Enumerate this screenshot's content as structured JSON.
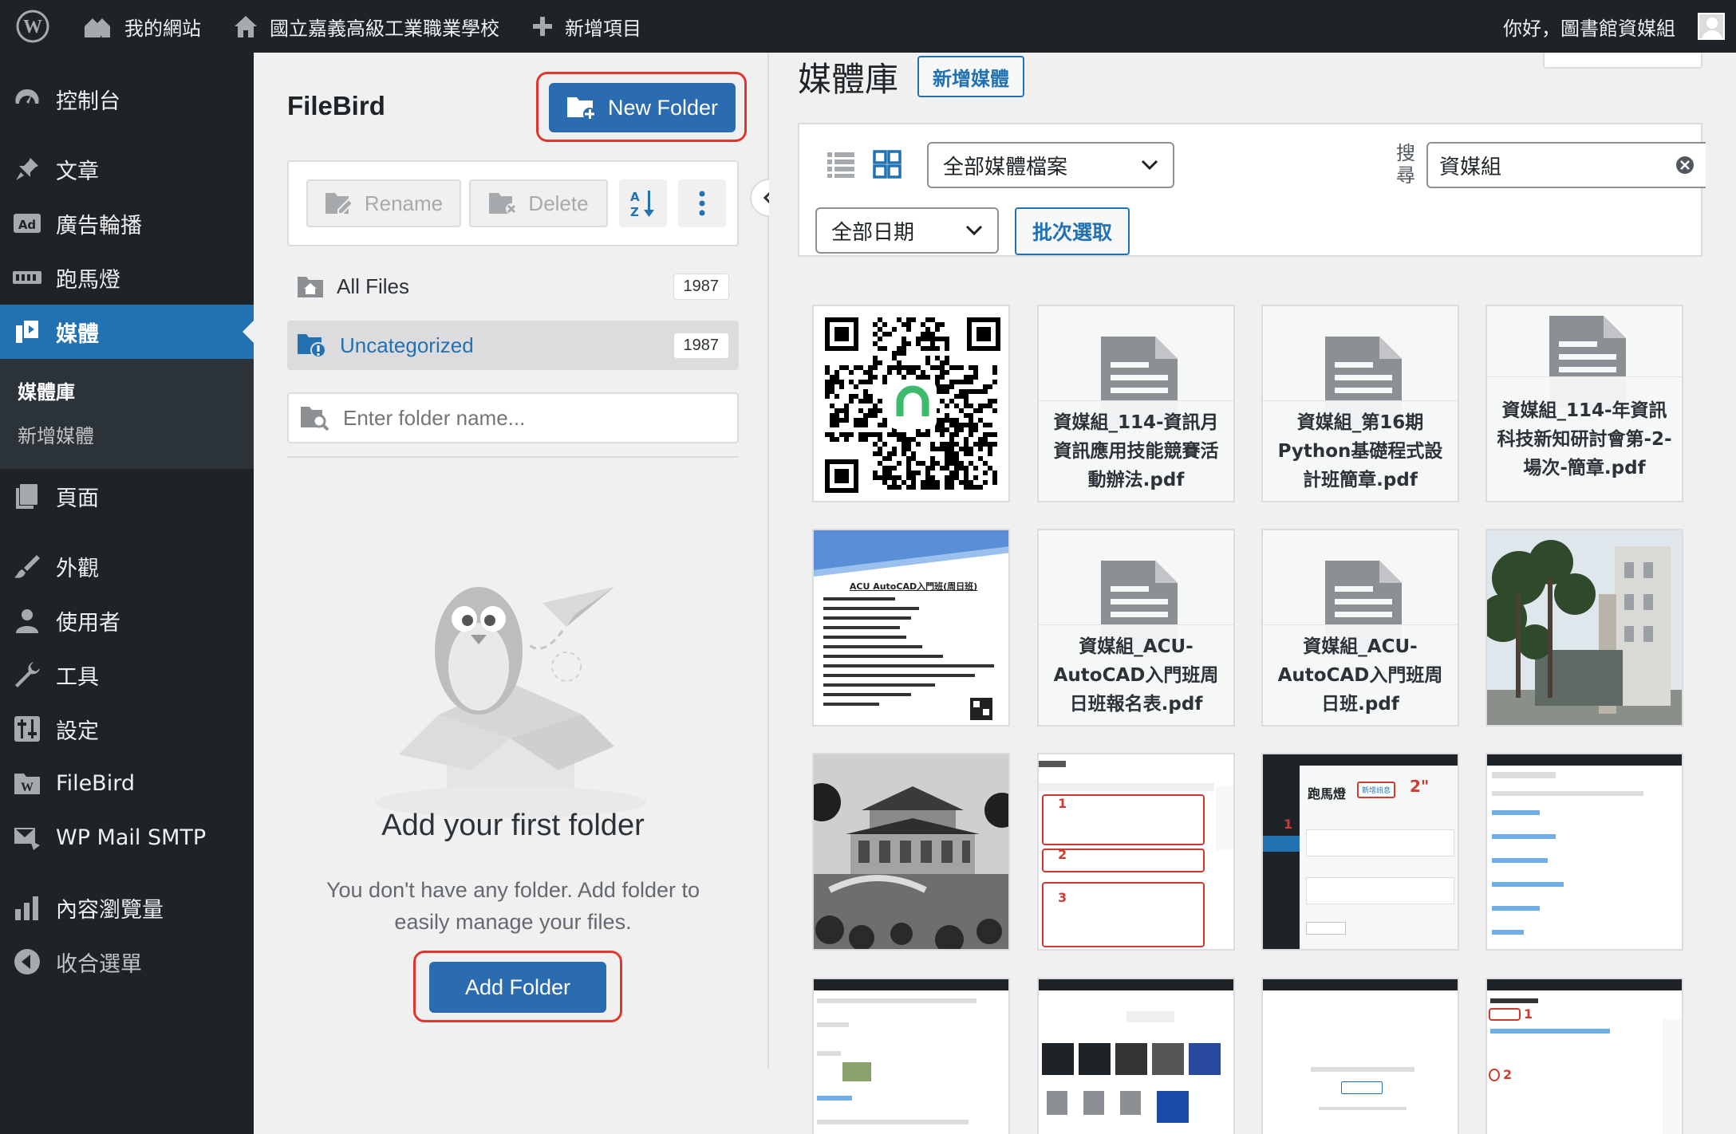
{
  "admin_bar": {
    "my_sites": "我的網站",
    "site_name": "國立嘉義高級工業職業學校",
    "new_item": "新增項目",
    "greeting": "你好，圖書館資媒組"
  },
  "sidebar": {
    "items": [
      {
        "label": "控制台",
        "icon": "dashboard-icon"
      },
      {
        "label": "文章",
        "icon": "pushpin-icon"
      },
      {
        "label": "廣告輪播",
        "icon": "ad-icon"
      },
      {
        "label": "跑馬燈",
        "icon": "marquee-icon"
      },
      {
        "label": "媒體",
        "icon": "media-icon"
      },
      {
        "label": "頁面",
        "icon": "page-icon"
      },
      {
        "label": "外觀",
        "icon": "brush-icon"
      },
      {
        "label": "使用者",
        "icon": "user-icon"
      },
      {
        "label": "工具",
        "icon": "wrench-icon"
      },
      {
        "label": "設定",
        "icon": "settings-icon"
      },
      {
        "label": "FileBird",
        "icon": "filebird-icon"
      },
      {
        "label": "WP Mail SMTP",
        "icon": "mail-icon"
      },
      {
        "label": "內容瀏覽量",
        "icon": "bar-chart-icon"
      },
      {
        "label": "收合選單",
        "icon": "collapse-icon"
      }
    ],
    "submenu": [
      "媒體庫",
      "新增媒體"
    ]
  },
  "filebird": {
    "title": "FileBird",
    "new_folder": "New Folder",
    "rename": "Rename",
    "delete": "Delete",
    "all_files": "All Files",
    "all_files_count": "1987",
    "uncategorized": "Uncategorized",
    "uncategorized_count": "1987",
    "folder_placeholder": "Enter folder name...",
    "empty_title": "Add your first folder",
    "empty_desc": "You don't have any folder. Add folder to easily manage your files.",
    "add_folder": "Add Folder"
  },
  "media": {
    "title": "媒體庫",
    "add_new": "新增媒體",
    "type_filter": "全部媒體檔案",
    "search_label": "搜尋",
    "search_value": "資媒組",
    "date_filter": "全部日期",
    "bulk_select": "批次選取",
    "tiles": [
      {
        "kind": "qr"
      },
      {
        "kind": "doc",
        "name": "資媒組_114-資訊月資訊應用技能競賽活動辦法.pdf"
      },
      {
        "kind": "doc",
        "name": "資媒組_第16期Python基礎程式設計班簡章.pdf"
      },
      {
        "kind": "doc",
        "name": "資媒組_114-年資訊科技新知研討會第-2-場次-簡章.pdf"
      },
      {
        "kind": "flyer",
        "title": "ACU AutoCAD入門班(周日班)"
      },
      {
        "kind": "doc",
        "name": "資媒組_ACU-AutoCAD入門班周日班報名表.pdf"
      },
      {
        "kind": "doc",
        "name": "資媒組_ACU-AutoCAD入門班周日班.pdf"
      },
      {
        "kind": "photo"
      },
      {
        "kind": "photo-bw"
      },
      {
        "kind": "screenshot"
      },
      {
        "kind": "screenshot-dark",
        "heading": "跑馬燈",
        "button": "新增訊息"
      },
      {
        "kind": "screenshot"
      },
      {
        "kind": "screenshot"
      },
      {
        "kind": "screenshot"
      },
      {
        "kind": "screenshot"
      },
      {
        "kind": "screenshot"
      }
    ]
  },
  "colors": {
    "admin_dark": "#1d2327",
    "accent": "#2271b1",
    "highlight": "#e0362f"
  }
}
